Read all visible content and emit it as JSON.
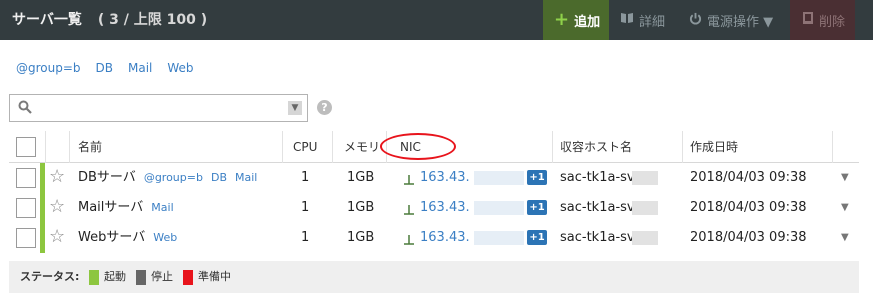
{
  "header": {
    "title": "サーバ一覧",
    "count": "( 3 / 上限 100 )",
    "add_label": "追加",
    "detail_label": "詳細",
    "power_label": "電源操作 ▼",
    "delete_label": "削除"
  },
  "tags": [
    "@group=b",
    "DB",
    "Mail",
    "Web"
  ],
  "search": {
    "placeholder": "",
    "help": "?"
  },
  "table": {
    "columns": [
      "名前",
      "CPU",
      "メモリ",
      "NIC",
      "収容ホスト名",
      "作成日時"
    ],
    "rows": [
      {
        "name": "DBサーバ",
        "tags": [
          "@group=b",
          "DB",
          "Mail"
        ],
        "cpu": "1",
        "memory": "1GB",
        "ip": "163.43.",
        "nic_extra": "+1",
        "host": "sac-tk1a-sv",
        "created": "2018/04/03 09:38"
      },
      {
        "name": "Mailサーバ",
        "tags": [
          "Mail"
        ],
        "cpu": "1",
        "memory": "1GB",
        "ip": "163.43.",
        "nic_extra": "+1",
        "host": "sac-tk1a-sv",
        "created": "2018/04/03 09:38"
      },
      {
        "name": "Webサーバ",
        "tags": [
          "Web"
        ],
        "cpu": "1",
        "memory": "1GB",
        "ip": "163.43.",
        "nic_extra": "+1",
        "host": "sac-tk1a-sv",
        "created": "2018/04/03 09:38"
      }
    ]
  },
  "legend": {
    "label": "ステータス:",
    "items": [
      {
        "label": "起動",
        "color": "#8dc63f"
      },
      {
        "label": "停止",
        "color": "#666666"
      },
      {
        "label": "準備中",
        "color": "#e8141c"
      }
    ]
  },
  "colors": {
    "header_bg": "#333c3f",
    "link": "#3b7fc4",
    "running": "#8dc63f",
    "annotation": "#e8141c"
  }
}
